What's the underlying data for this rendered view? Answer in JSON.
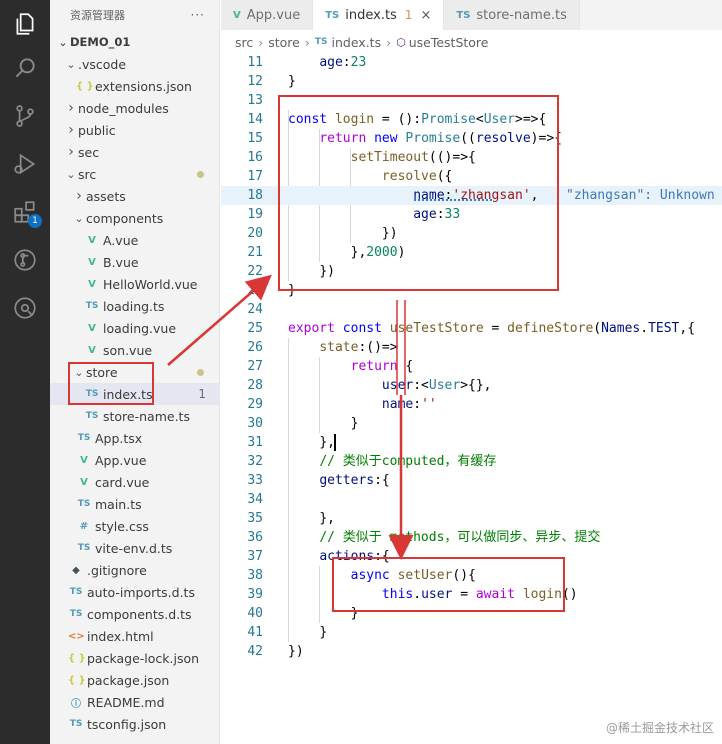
{
  "explorer": {
    "title": "资源管理器",
    "more": "···",
    "tree": [
      {
        "label": "DEMO_01",
        "indent": 0,
        "chevron": "down",
        "bold": true
      },
      {
        "label": ".vscode",
        "indent": 1,
        "chevron": "down"
      },
      {
        "label": "extensions.json",
        "indent": 2,
        "icon": "{ }",
        "icon_class": "json"
      },
      {
        "label": "node_modules",
        "indent": 1,
        "chevron": "right"
      },
      {
        "label": "public",
        "indent": 1,
        "chevron": "right"
      },
      {
        "label": "sec",
        "indent": 1,
        "chevron": "right"
      },
      {
        "label": "src",
        "indent": 1,
        "chevron": "down",
        "dot": true
      },
      {
        "label": "assets",
        "indent": 2,
        "chevron": "right"
      },
      {
        "label": "components",
        "indent": 2,
        "chevron": "down"
      },
      {
        "label": "A.vue",
        "indent": 3,
        "icon": "V",
        "icon_class": "vue"
      },
      {
        "label": "B.vue",
        "indent": 3,
        "icon": "V",
        "icon_class": "vue"
      },
      {
        "label": "HelloWorld.vue",
        "indent": 3,
        "icon": "V",
        "icon_class": "vue"
      },
      {
        "label": "loading.ts",
        "indent": 3,
        "icon": "TS",
        "icon_class": "ts"
      },
      {
        "label": "loading.vue",
        "indent": 3,
        "icon": "V",
        "icon_class": "vue"
      },
      {
        "label": "son.vue",
        "indent": 3,
        "icon": "V",
        "icon_class": "vue"
      },
      {
        "label": "store",
        "indent": 2,
        "chevron": "down",
        "dot": true
      },
      {
        "label": "index.ts",
        "indent": 3,
        "icon": "TS",
        "icon_class": "ts",
        "count": "1",
        "selected": true
      },
      {
        "label": "store-name.ts",
        "indent": 3,
        "icon": "TS",
        "icon_class": "ts"
      },
      {
        "label": "App.tsx",
        "indent": 2,
        "icon": "TS",
        "icon_class": "ts"
      },
      {
        "label": "App.vue",
        "indent": 2,
        "icon": "V",
        "icon_class": "vue"
      },
      {
        "label": "card.vue",
        "indent": 2,
        "icon": "V",
        "icon_class": "vue"
      },
      {
        "label": "main.ts",
        "indent": 2,
        "icon": "TS",
        "icon_class": "ts"
      },
      {
        "label": "style.css",
        "indent": 2,
        "icon": "#",
        "icon_class": "css"
      },
      {
        "label": "vite-env.d.ts",
        "indent": 2,
        "icon": "TS",
        "icon_class": "ts"
      },
      {
        "label": ".gitignore",
        "indent": 1,
        "icon": "◆",
        "icon_class": "git"
      },
      {
        "label": "auto-imports.d.ts",
        "indent": 1,
        "icon": "TS",
        "icon_class": "ts"
      },
      {
        "label": "components.d.ts",
        "indent": 1,
        "icon": "TS",
        "icon_class": "ts"
      },
      {
        "label": "index.html",
        "indent": 1,
        "icon": "<>",
        "icon_class": "html"
      },
      {
        "label": "package-lock.json",
        "indent": 1,
        "icon": "{ }",
        "icon_class": "json"
      },
      {
        "label": "package.json",
        "indent": 1,
        "icon": "{ }",
        "icon_class": "json"
      },
      {
        "label": "README.md",
        "indent": 1,
        "icon": "ⓘ",
        "icon_class": "info"
      },
      {
        "label": "tsconfig.json",
        "indent": 1,
        "icon": "TS",
        "icon_class": "ts"
      }
    ]
  },
  "activity": {
    "extensions_badge": "1"
  },
  "tabs": [
    {
      "icon": "V",
      "label": "App.vue",
      "active": false
    },
    {
      "icon": "TS",
      "label": "index.ts",
      "active": true,
      "problems": "1",
      "close": "×"
    },
    {
      "icon": "TS",
      "label": "store-name.ts",
      "active": false
    }
  ],
  "breadcrumb": {
    "parts": [
      "src",
      "store",
      "index.ts",
      "useTestStore"
    ],
    "separator": "›",
    "ts_icon": "TS",
    "symbol_icon": "⬡"
  },
  "editor": {
    "lines": [
      {
        "n": "11",
        "tokens": [
          [
            "    ",
            ""
          ],
          [
            "age",
            "prop"
          ],
          [
            ":",
            ""
          ],
          [
            "23",
            "num"
          ]
        ]
      },
      {
        "n": "12",
        "tokens": [
          [
            "}",
            ""
          ]
        ]
      },
      {
        "n": "13",
        "tokens": []
      },
      {
        "n": "14",
        "tokens": [
          [
            "const ",
            "kw"
          ],
          [
            "login",
            "fn"
          ],
          [
            " = ():",
            ""
          ],
          [
            "Promise",
            "ty"
          ],
          [
            "<",
            ""
          ],
          [
            "User",
            "ty"
          ],
          [
            ">=>{",
            ""
          ]
        ]
      },
      {
        "n": "15",
        "tokens": [
          [
            "    ",
            ""
          ],
          [
            "return ",
            "kw2"
          ],
          [
            "new ",
            "kw"
          ],
          [
            "Promise",
            "ty"
          ],
          [
            "((",
            ""
          ],
          [
            "resolve",
            "prop"
          ],
          [
            ")=>{",
            ""
          ]
        ]
      },
      {
        "n": "16",
        "tokens": [
          [
            "        ",
            ""
          ],
          [
            "setTimeout",
            "fn"
          ],
          [
            "(()=>{",
            ""
          ]
        ]
      },
      {
        "n": "17",
        "tokens": [
          [
            "            ",
            ""
          ],
          [
            "resolve",
            "fn"
          ],
          [
            "({",
            ""
          ]
        ]
      },
      {
        "n": "18",
        "tokens": [
          [
            "                ",
            ""
          ],
          [
            "name",
            "prop"
          ],
          [
            ":",
            ""
          ],
          [
            "'zhangsan'",
            "str"
          ],
          [
            ",",
            ""
          ]
        ],
        "highlight": true,
        "ghost": "\"zhangsan\": Unknown w"
      },
      {
        "n": "19",
        "tokens": [
          [
            "                ",
            ""
          ],
          [
            "age",
            "prop"
          ],
          [
            ":",
            ""
          ],
          [
            "33",
            "num"
          ]
        ]
      },
      {
        "n": "20",
        "tokens": [
          [
            "            ",
            ""
          ],
          [
            "})",
            ""
          ]
        ]
      },
      {
        "n": "21",
        "tokens": [
          [
            "        ",
            ""
          ],
          [
            "},",
            ""
          ],
          [
            "2000",
            "num"
          ],
          [
            ")",
            ""
          ]
        ]
      },
      {
        "n": "22",
        "tokens": [
          [
            "    ",
            ""
          ],
          [
            "})",
            ""
          ]
        ]
      },
      {
        "n": "23",
        "tokens": [
          [
            "}",
            ""
          ]
        ]
      },
      {
        "n": "24",
        "tokens": []
      },
      {
        "n": "25",
        "tokens": [
          [
            "export ",
            "kw2"
          ],
          [
            "const ",
            "kw"
          ],
          [
            "useTestStore",
            "fn"
          ],
          [
            " = ",
            ""
          ],
          [
            "defineStore",
            "fn"
          ],
          [
            "(",
            ""
          ],
          [
            "Names",
            "prop"
          ],
          [
            ".",
            ""
          ],
          [
            "TEST",
            "prop"
          ],
          [
            ",{",
            ""
          ]
        ]
      },
      {
        "n": "26",
        "tokens": [
          [
            "    ",
            ""
          ],
          [
            "state",
            "fn"
          ],
          [
            ":()=>",
            ""
          ]
        ]
      },
      {
        "n": "27",
        "tokens": [
          [
            "        ",
            ""
          ],
          [
            "return ",
            "kw2"
          ],
          [
            "{",
            ""
          ]
        ]
      },
      {
        "n": "28",
        "tokens": [
          [
            "            ",
            ""
          ],
          [
            "user",
            "prop"
          ],
          [
            ":<",
            ""
          ],
          [
            "User",
            "ty"
          ],
          [
            ">{},",
            ""
          ]
        ]
      },
      {
        "n": "29",
        "tokens": [
          [
            "            ",
            ""
          ],
          [
            "name",
            "prop"
          ],
          [
            ":",
            ""
          ],
          [
            "''",
            "str"
          ]
        ]
      },
      {
        "n": "30",
        "tokens": [
          [
            "        ",
            ""
          ],
          [
            "}",
            ""
          ]
        ]
      },
      {
        "n": "31",
        "tokens": [
          [
            "    ",
            ""
          ],
          [
            "},",
            ""
          ]
        ]
      },
      {
        "n": "32",
        "tokens": [
          [
            "    ",
            ""
          ],
          [
            "// 类似于computed，有缓存",
            "cmt"
          ]
        ]
      },
      {
        "n": "33",
        "tokens": [
          [
            "    ",
            ""
          ],
          [
            "getters",
            "prop"
          ],
          [
            ":{",
            ""
          ]
        ]
      },
      {
        "n": "34",
        "tokens": []
      },
      {
        "n": "35",
        "tokens": [
          [
            "    ",
            ""
          ],
          [
            "},",
            ""
          ]
        ]
      },
      {
        "n": "36",
        "tokens": [
          [
            "    ",
            ""
          ],
          [
            "// 类似于 methods，可以做同步、异步、提交",
            "cmt"
          ]
        ]
      },
      {
        "n": "37",
        "tokens": [
          [
            "    ",
            ""
          ],
          [
            "actions",
            "prop"
          ],
          [
            ":{",
            ""
          ]
        ]
      },
      {
        "n": "38",
        "tokens": [
          [
            "        ",
            ""
          ],
          [
            "async ",
            "kw"
          ],
          [
            "setUser",
            "fn"
          ],
          [
            "(){",
            ""
          ]
        ]
      },
      {
        "n": "39",
        "tokens": [
          [
            "            ",
            ""
          ],
          [
            "this",
            "kw"
          ],
          [
            ".",
            ""
          ],
          [
            "user",
            "prop"
          ],
          [
            " = ",
            ""
          ],
          [
            "await ",
            "kw2"
          ],
          [
            "login",
            "fn"
          ],
          [
            "()",
            ""
          ]
        ]
      },
      {
        "n": "40",
        "tokens": [
          [
            "        ",
            ""
          ],
          [
            "}",
            ""
          ]
        ]
      },
      {
        "n": "41",
        "tokens": [
          [
            "    ",
            ""
          ],
          [
            "}",
            ""
          ]
        ]
      },
      {
        "n": "42",
        "tokens": [
          [
            "})",
            ""
          ]
        ]
      }
    ]
  },
  "watermark": "@稀土掘金技术社区",
  "colors": {
    "annotation_red": "#d93636",
    "activity_bar": "#2c2c2c",
    "sidebar": "#f3f3f3"
  }
}
